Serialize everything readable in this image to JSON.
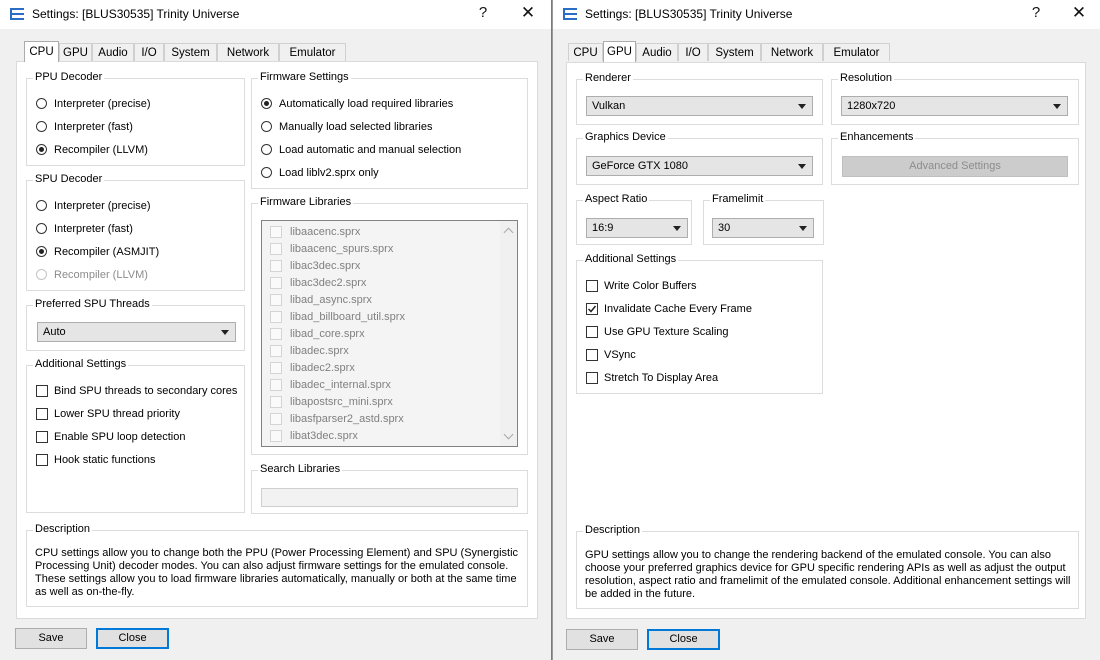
{
  "left": {
    "title": "Settings: [BLUS30535] Trinity Universe",
    "help": "?",
    "close": "✕",
    "tabs": [
      "CPU",
      "GPU",
      "Audio",
      "I/O",
      "System",
      "Network",
      "Emulator"
    ],
    "ppu": {
      "title": "PPU Decoder",
      "options": [
        "Interpreter (precise)",
        "Interpreter (fast)",
        "Recompiler (LLVM)"
      ]
    },
    "spu": {
      "title": "SPU Decoder",
      "options": [
        "Interpreter (precise)",
        "Interpreter (fast)",
        "Recompiler (ASMJIT)",
        "Recompiler (LLVM)"
      ]
    },
    "threads": {
      "title": "Preferred SPU Threads",
      "value": "Auto"
    },
    "additional": {
      "title": "Additional Settings",
      "items": [
        "Bind SPU threads to secondary cores",
        "Lower SPU thread priority",
        "Enable SPU loop detection",
        "Hook static functions"
      ]
    },
    "firmware": {
      "title": "Firmware Settings",
      "options": [
        "Automatically load required libraries",
        "Manually load selected libraries",
        "Load automatic and manual selection",
        "Load liblv2.sprx only"
      ]
    },
    "libraries": {
      "title": "Firmware Libraries",
      "items": [
        "libaacenc.sprx",
        "libaacenc_spurs.sprx",
        "libac3dec.sprx",
        "libac3dec2.sprx",
        "libad_async.sprx",
        "libad_billboard_util.sprx",
        "libad_core.sprx",
        "libadec.sprx",
        "libadec2.sprx",
        "libadec_internal.sprx",
        "libapostsrc_mini.sprx",
        "libasfparser2_astd.sprx",
        "libat3dec.sprx"
      ]
    },
    "search": {
      "title": "Search Libraries",
      "value": ""
    },
    "description": {
      "title": "Description",
      "lines": [
        "CPU settings allow you to change both the PPU (Power Processing Element) and SPU (Synergistic",
        "Processing Unit) decoder modes. You can also adjust firmware settings for the emulated console.",
        "These settings allow you to load firmware libraries automatically, manually or both at the same time",
        "as well as on-the-fly."
      ]
    },
    "save": "Save",
    "close_btn": "Close"
  },
  "right": {
    "title": "Settings: [BLUS30535] Trinity Universe",
    "help": "?",
    "close": "✕",
    "tabs": [
      "CPU",
      "GPU",
      "Audio",
      "I/O",
      "System",
      "Network",
      "Emulator"
    ],
    "renderer": {
      "title": "Renderer",
      "value": "Vulkan"
    },
    "resolution": {
      "title": "Resolution",
      "value": "1280x720"
    },
    "device": {
      "title": "Graphics Device",
      "value": "GeForce GTX 1080"
    },
    "enhancements": {
      "title": "Enhancements",
      "button": "Advanced Settings"
    },
    "aspect": {
      "title": "Aspect Ratio",
      "value": "16:9"
    },
    "framelimit": {
      "title": "Framelimit",
      "value": "30"
    },
    "additional": {
      "title": "Additional Settings",
      "items": [
        "Write Color Buffers",
        "Invalidate Cache Every Frame",
        "Use GPU Texture Scaling",
        "VSync",
        "Stretch To Display Area"
      ]
    },
    "description": {
      "title": "Description",
      "lines": [
        "GPU settings allow you to change the rendering backend of the emulated console. You can also",
        "choose your preferred graphics device for GPU specific rendering APIs as well as adjust the output",
        "resolution, aspect ratio and framelimit of the emulated console. Additional enhancement settings will",
        "be added in the future."
      ]
    },
    "save": "Save",
    "close_btn": "Close"
  }
}
